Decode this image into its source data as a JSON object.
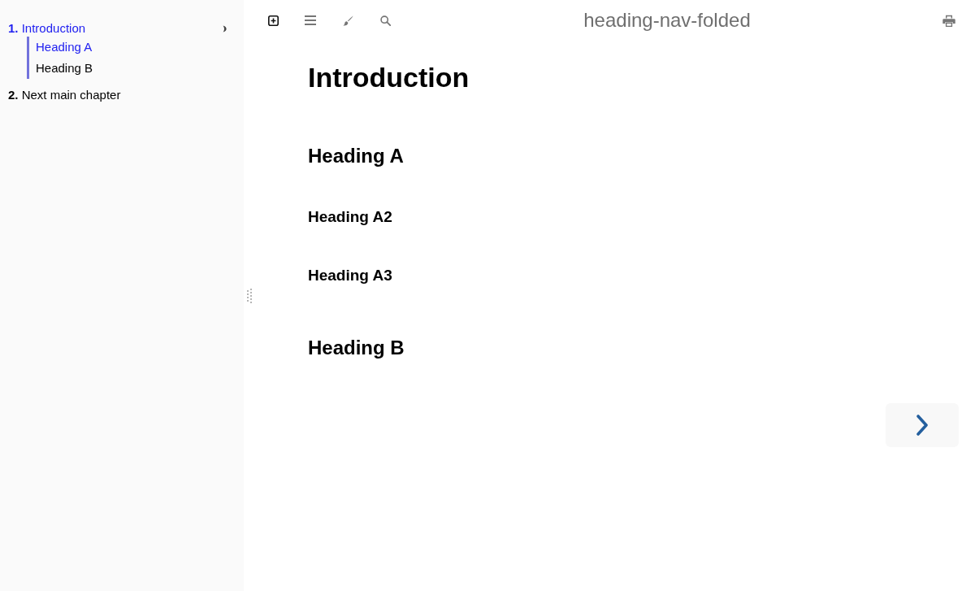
{
  "sidebar": {
    "chapters": [
      {
        "number": "1.",
        "title": "Introduction",
        "selected": true,
        "expanded": true,
        "children": [
          {
            "title": "Heading A",
            "selected": true
          },
          {
            "title": "Heading B",
            "selected": false
          }
        ]
      },
      {
        "number": "2.",
        "title": "Next main chapter",
        "selected": false
      }
    ]
  },
  "menu_bar": {
    "title": "heading-nav-folded"
  },
  "content": {
    "headings": [
      {
        "kind": "h1",
        "text": "Introduction"
      },
      {
        "kind": "h2",
        "text": "Heading A"
      },
      {
        "kind": "h3",
        "text": "Heading A2"
      },
      {
        "kind": "h3",
        "text": "Heading A3"
      },
      {
        "kind": "h2",
        "text": "Heading B"
      }
    ]
  }
}
